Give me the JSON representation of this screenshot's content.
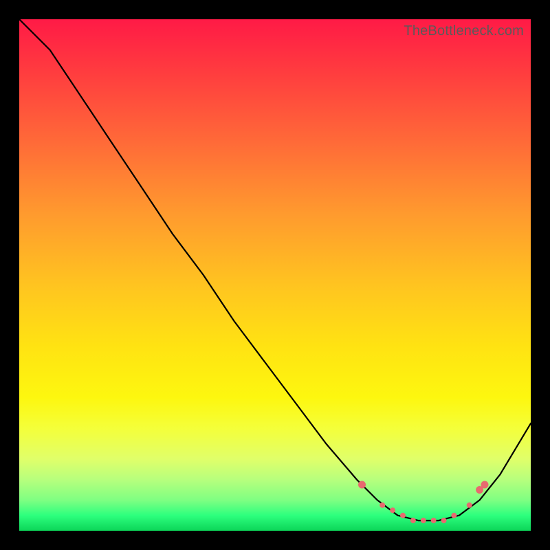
{
  "watermark": "TheBottleneck.com",
  "colors": {
    "dot": "#e86a6f",
    "curve": "#000000",
    "frame": "#000000"
  },
  "chart_data": {
    "type": "line",
    "title": "",
    "xlabel": "",
    "ylabel": "",
    "xlim": [
      0,
      100
    ],
    "ylim": [
      0,
      100
    ],
    "grid": false,
    "legend": false,
    "series": [
      {
        "name": "bottleneck-curve",
        "x": [
          0,
          6,
          12,
          18,
          24,
          30,
          36,
          42,
          48,
          54,
          60,
          66,
          70,
          74,
          78,
          82,
          86,
          90,
          94,
          100
        ],
        "y": [
          100,
          94,
          85,
          76,
          67,
          58,
          50,
          41,
          33,
          25,
          17,
          10,
          6,
          3,
          2,
          2,
          3,
          6,
          11,
          21
        ]
      }
    ],
    "markers": {
      "name": "trough-dots",
      "x": [
        67,
        71,
        73,
        75,
        77,
        79,
        81,
        83,
        85,
        88,
        90,
        91
      ],
      "y": [
        9,
        5,
        4,
        3,
        2,
        2,
        2,
        2,
        3,
        5,
        8,
        9
      ]
    }
  }
}
